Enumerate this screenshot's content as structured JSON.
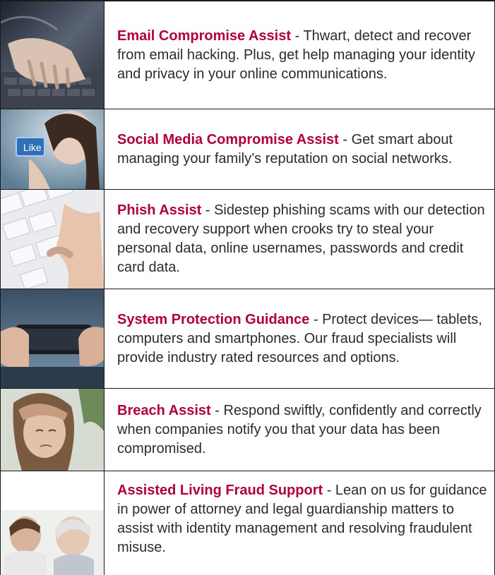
{
  "services": [
    {
      "title": "Email Compromise Assist",
      "separator": " - ",
      "description": "Thwart, detect and recover from email hacking. Plus, get help managing your identity and privacy in your online communications.",
      "image": "hands-typing-keyboard"
    },
    {
      "title": "Social Media Compromise Assist",
      "separator": " - ",
      "description": "Get smart about managing your family’s reputation on social networks.",
      "image": "woman-pressing-like-button"
    },
    {
      "title": "Phish Assist",
      "separator": " - ",
      "description": "Sidestep phishing scams with our detection and recovery support when crooks try to steal your personal data, online usernames, passwords and credit card data.",
      "image": "finger-on-keyboard"
    },
    {
      "title": "System Protection Guidance",
      "separator": " - ",
      "description": "Protect devices— tablets, computers and smartphones. Our fraud specialists will provide industry rated resources and options.",
      "image": "hands-holding-smartphone"
    },
    {
      "title": "Breach Assist",
      "separator": " - ",
      "description": "Respond swiftly, confidently and correctly when companies notify you that your data has been compromised.",
      "image": "worried-woman"
    },
    {
      "title": "Assisted Living Fraud Support",
      "separator": " - ",
      "description": "Lean on us for guidance in power of attorney and legal guardianship matters to assist with identity management and resolving fraudulent misuse.",
      "image": "caregiver-with-elder"
    }
  ]
}
